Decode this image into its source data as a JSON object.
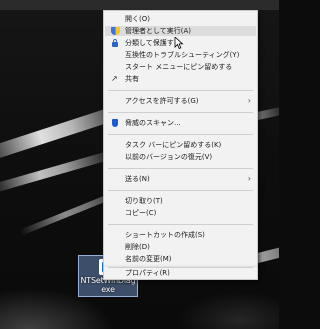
{
  "desktop_icon": {
    "name_line1": "NTSetWinDiag",
    "name_line2": "exe"
  },
  "context_menu": {
    "items": [
      {
        "label": "開く(O)",
        "icon": "none"
      },
      {
        "label": "管理者として実行(A)",
        "icon": "uac-shield-icon",
        "highlighted": true
      },
      {
        "label": "分類して保護する",
        "icon": "lock-icon"
      },
      {
        "label": "互換性のトラブルシューティング(Y)",
        "icon": "none"
      },
      {
        "label": "スタート メニューにピン留めする",
        "icon": "none"
      },
      {
        "label": "共有",
        "icon": "share-icon"
      },
      {
        "label": "アクセスを許可する(G)",
        "icon": "none",
        "submenu": true
      },
      {
        "label": "脅威のスキャン...",
        "icon": "defender-icon"
      },
      {
        "label": "タスク バーにピン留めする(K)",
        "icon": "none"
      },
      {
        "label": "以前のバージョンの復元(V)",
        "icon": "none"
      },
      {
        "label": "送る(N)",
        "icon": "none",
        "submenu": true
      },
      {
        "label": "切り取り(T)",
        "icon": "none"
      },
      {
        "label": "コピー(C)",
        "icon": "none"
      },
      {
        "label": "ショートカットの作成(S)",
        "icon": "none"
      },
      {
        "label": "削除(D)",
        "icon": "none"
      },
      {
        "label": "名前の変更(M)",
        "icon": "none"
      },
      {
        "label": "プロパティ(R)",
        "icon": "none"
      }
    ],
    "submenu_arrow": "›"
  },
  "share_glyph": "↗"
}
